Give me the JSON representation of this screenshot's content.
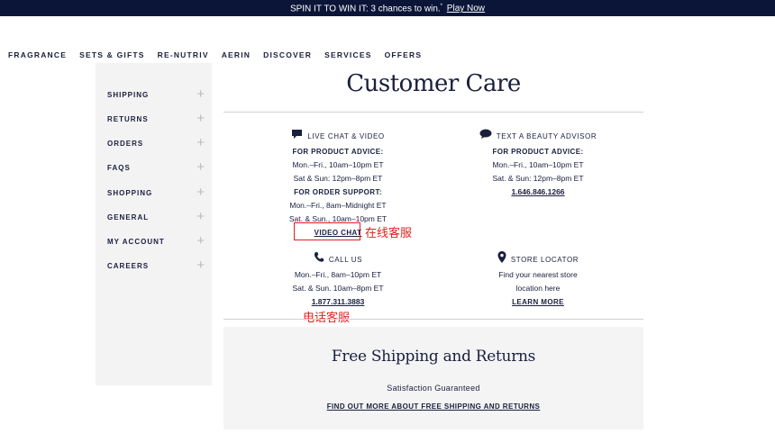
{
  "promo": {
    "text": "SPIN IT TO WIN IT: 3 chances to win.",
    "mark": "*",
    "link": "Play Now"
  },
  "nav": [
    "FRAGRANCE",
    "SETS & GIFTS",
    "RE-NUTRIV",
    "AERIN",
    "DISCOVER",
    "SERVICES",
    "OFFERS"
  ],
  "sidebar": {
    "items": [
      {
        "label": "SHIPPING"
      },
      {
        "label": "RETURNS"
      },
      {
        "label": "ORDERS"
      },
      {
        "label": "FAQS"
      },
      {
        "label": "SHOPPING"
      },
      {
        "label": "GENERAL"
      },
      {
        "label": "MY ACCOUNT"
      },
      {
        "label": "CAREERS"
      }
    ],
    "expand_glyph": "+"
  },
  "page_title": "Customer Care",
  "live_chat": {
    "heading": "LIVE CHAT & VIDEO",
    "product_label": "FOR PRODUCT ADVICE:",
    "product_hours_1": "Mon.–Fri., 10am–10pm ET",
    "product_hours_2": "Sat & Sun: 12pm–8pm ET",
    "order_label": "FOR ORDER SUPPORT:",
    "order_hours_1": "Mon.–Fri., 8am–Midnight ET",
    "order_hours_2": "Sat. & Sun., 10am–10pm ET",
    "link": "VIDEO CHAT"
  },
  "text_advisor": {
    "heading": "TEXT A BEAUTY ADVISOR",
    "product_label": "FOR PRODUCT ADVICE:",
    "hours_1": "Mon.–Fri., 10am–10pm ET",
    "hours_2": "Sat. & Sun: 12pm–8pm ET",
    "phone": "1.646.846.1266"
  },
  "call_us": {
    "heading": "CALL US",
    "hours_1": "Mon.–Fri., 8am–10pm ET",
    "hours_2": "Sat. & Sun. 10am–8pm ET",
    "phone": "1.877.311.3883"
  },
  "store_locator": {
    "heading": "STORE LOCATOR",
    "line_1": "Find your nearest store",
    "line_2": "location here",
    "link": "LEARN MORE"
  },
  "annotations": {
    "online_service": "在线客服",
    "phone_service": "电话客服"
  },
  "shipping": {
    "title": "Free Shipping and Returns",
    "subtitle": "Satisfaction Guaranteed",
    "link": "FIND OUT MORE ABOUT FREE SHIPPING AND RETURNS"
  },
  "colors": {
    "navy": "#0b1538",
    "text": "#1a1f3d",
    "sidebar_bg": "#f3f3f4",
    "annotation": "#e02020"
  }
}
